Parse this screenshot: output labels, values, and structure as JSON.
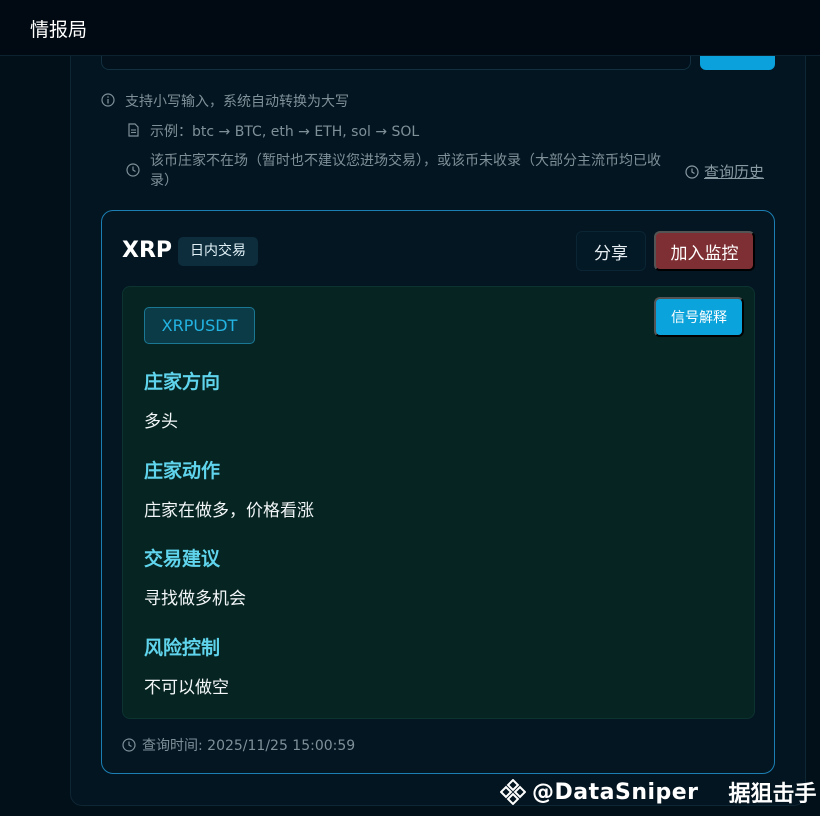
{
  "app": {
    "title": "情报局"
  },
  "hints": {
    "lowercase": "支持小写输入，系统自动转换为大写",
    "example": "示例：btc → BTC, eth → ETH, sol → SOL",
    "not_found": "该币庄家不在场（暂时也不建议您进场交易），或该币未收录（大部分主流币均已收录）",
    "history_link": "查询历史"
  },
  "result": {
    "symbol": "XRP",
    "badge": "日内交易",
    "share_label": "分享",
    "monitor_label": "加入监控",
    "pair": "XRPUSDT",
    "explain_label": "信号解释",
    "sections": [
      {
        "title": "庄家方向",
        "value": "多头"
      },
      {
        "title": "庄家动作",
        "value": "庄家在做多，价格看涨"
      },
      {
        "title": "交易建议",
        "value": "寻找做多机会"
      },
      {
        "title": "风险控制",
        "value": "不可以做空"
      }
    ],
    "query_time": "查询时间: 2025/11/25 15:00:59"
  },
  "watermark": {
    "handle": "@DataSniper",
    "name": "据狙击手"
  },
  "colors": {
    "accent_blue": "#0aa3db",
    "monitor_red": "#7e2f33",
    "section_title": "#5fd4ec",
    "card_border": "#1c7fb3"
  }
}
